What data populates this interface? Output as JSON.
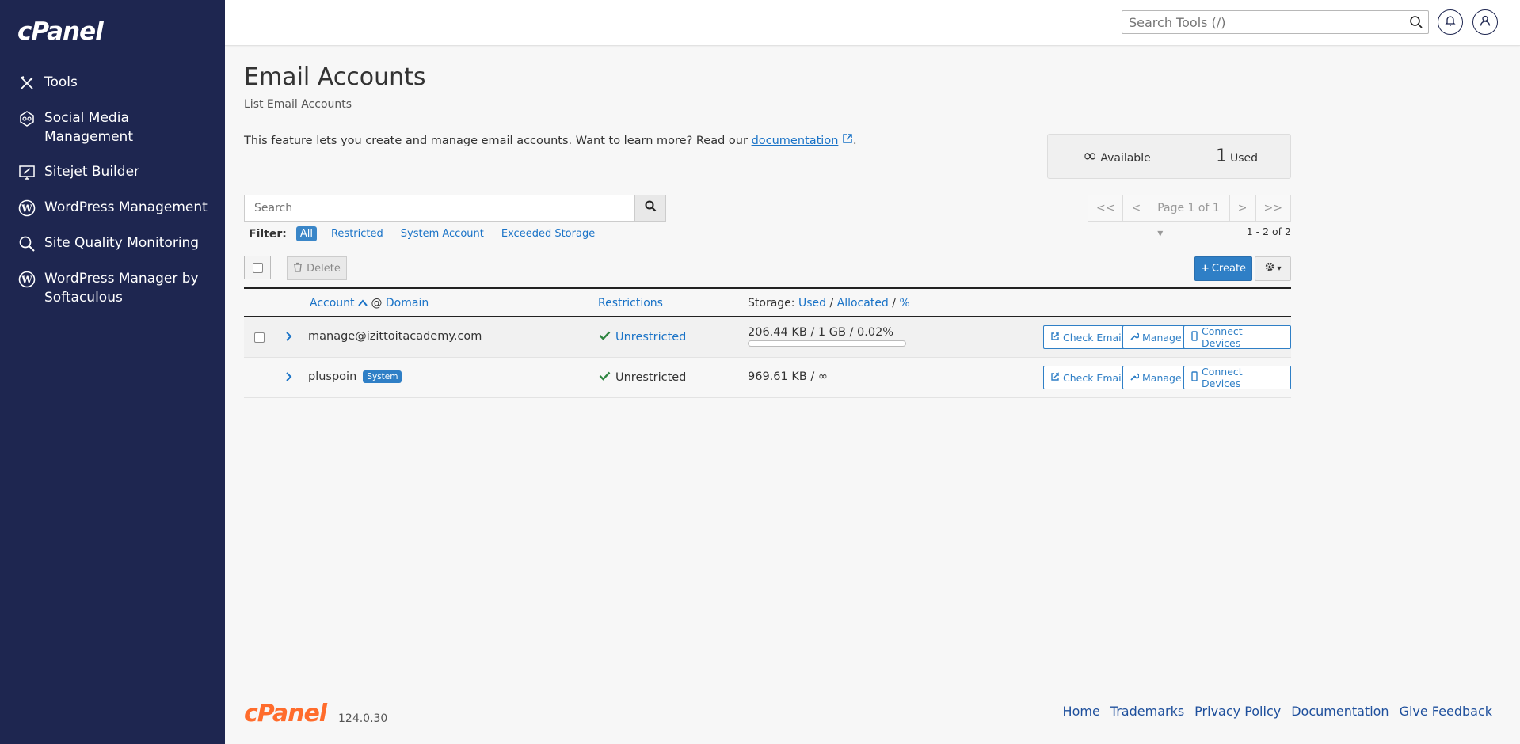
{
  "brand": {
    "logo": "cPanel"
  },
  "sidebar": {
    "items": [
      {
        "label": "Tools",
        "icon": "tools-icon"
      },
      {
        "label": "Social Media Management",
        "icon": "social-media-icon"
      },
      {
        "label": "Sitejet Builder",
        "icon": "sitejet-icon"
      },
      {
        "label": "WordPress Management",
        "icon": "wordpress-icon"
      },
      {
        "label": "Site Quality Monitoring",
        "icon": "site-quality-icon"
      },
      {
        "label": "WordPress Manager by Softaculous",
        "icon": "wordpress-icon"
      }
    ]
  },
  "topbar": {
    "search_placeholder": "Search Tools (/)"
  },
  "page": {
    "title": "Email Accounts",
    "subtitle": "List Email Accounts",
    "intro_text": "This feature lets you create and manage email accounts. Want to learn more? Read our ",
    "intro_link": "documentation",
    "intro_end": "."
  },
  "stats": {
    "available_value": "∞",
    "available_label": "Available",
    "used_value": "1",
    "used_label": "Used"
  },
  "search": {
    "placeholder": "Search"
  },
  "filter": {
    "label": "Filter:",
    "options": [
      "All",
      "Restricted",
      "System Account",
      "Exceeded Storage"
    ],
    "active": "All"
  },
  "pager": {
    "first": "<<",
    "prev": "<",
    "page": "Page 1 of 1",
    "next": ">",
    "last": ">>",
    "range": "1 - 2 of 2"
  },
  "toolbar": {
    "delete_label": "Delete",
    "create_label": "Create"
  },
  "table": {
    "headers": {
      "account": "Account",
      "at": "@",
      "domain": "Domain",
      "restrictions": "Restrictions",
      "storage_prefix": "Storage:",
      "used": "Used",
      "allocated": "Allocated",
      "percent": "%"
    },
    "rows": [
      {
        "account": "manage@izittoitacademy.com",
        "badge": "",
        "restriction": "Unrestricted",
        "storage": "206.44 KB / 1 GB / 0.02%",
        "usage_fraction": 0.0002
      },
      {
        "account": "pluspoin",
        "badge": "System",
        "restriction": "Unrestricted",
        "storage": "969.61 KB / ∞"
      }
    ],
    "actions": {
      "check_email": "Check Email",
      "manage": "Manage",
      "connect_devices": "Connect Devices"
    }
  },
  "footer": {
    "logo": "cPanel",
    "version": "124.0.30",
    "links": [
      "Home",
      "Trademarks",
      "Privacy Policy",
      "Documentation",
      "Give Feedback"
    ]
  },
  "colors": {
    "sidebar_bg": "#1e2650",
    "accent": "#2f7fc6",
    "success": "#2e8540",
    "footer_logo": "#ff6c2c"
  }
}
